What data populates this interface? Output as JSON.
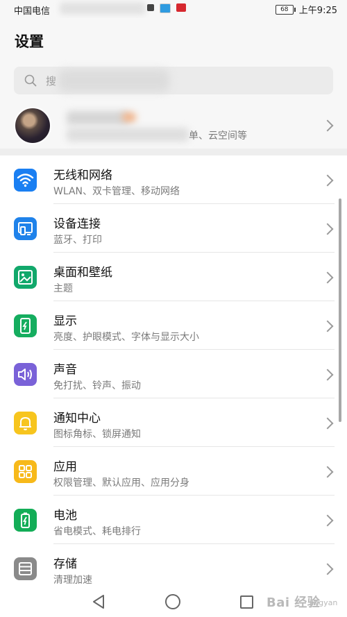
{
  "status_bar": {
    "carrier": "中国电信",
    "battery": "68",
    "time": "上午9:25"
  },
  "header": {
    "title": "设置"
  },
  "search": {
    "placeholder": "搜"
  },
  "account": {
    "subtitle": "单、云空间等"
  },
  "settings": [
    {
      "id": "wlan",
      "title": "无线和网络",
      "subtitle": "WLAN、双卡管理、移动网络",
      "icon": "wifi-icon",
      "color": "#1a7ff2"
    },
    {
      "id": "device",
      "title": "设备连接",
      "subtitle": "蓝牙、打印",
      "icon": "device-connect-icon",
      "color": "#1f82ea"
    },
    {
      "id": "desktop",
      "title": "桌面和壁纸",
      "subtitle": "主题",
      "icon": "wallpaper-icon",
      "color": "#11a86b"
    },
    {
      "id": "display",
      "title": "显示",
      "subtitle": "亮度、护眼模式、字体与显示大小",
      "icon": "display-icon",
      "color": "#15ad5f"
    },
    {
      "id": "sound",
      "title": "声音",
      "subtitle": "免打扰、铃声、振动",
      "icon": "speaker-icon",
      "color": "#7a62d8"
    },
    {
      "id": "notify",
      "title": "通知中心",
      "subtitle": "图标角标、锁屏通知",
      "icon": "bell-icon",
      "color": "#f7c51e"
    },
    {
      "id": "apps",
      "title": "应用",
      "subtitle": "权限管理、默认应用、应用分身",
      "icon": "apps-icon",
      "color": "#f7b91a"
    },
    {
      "id": "battery",
      "title": "电池",
      "subtitle": "省电模式、耗电排行",
      "icon": "battery-icon",
      "color": "#13ad57"
    },
    {
      "id": "storage",
      "title": "存储",
      "subtitle": "清理加速",
      "icon": "storage-icon",
      "color": "#8a8a8a"
    }
  ],
  "watermark": {
    "text": "Bai 经验",
    "sub": "jingyan"
  }
}
